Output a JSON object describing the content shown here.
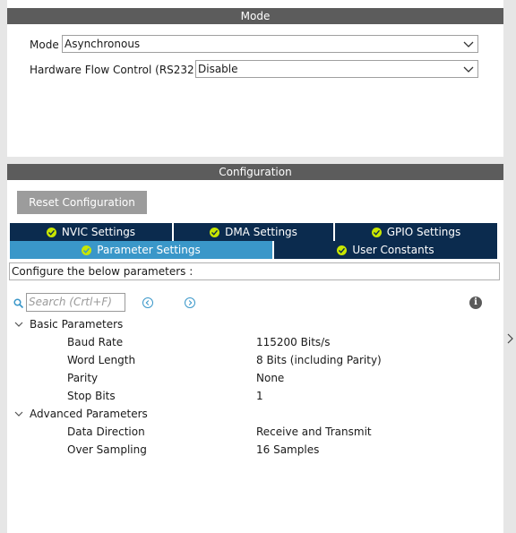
{
  "mode_panel": {
    "header": "Mode",
    "mode_label": "Mode",
    "mode_value": "Asynchronous",
    "flow_label": "Hardware Flow Control (RS232)",
    "flow_value": "Disable"
  },
  "config_panel": {
    "header": "Configuration",
    "reset_button": "Reset Configuration",
    "tabs": [
      {
        "label": "NVIC Settings",
        "active": false
      },
      {
        "label": "DMA Settings",
        "active": false
      },
      {
        "label": "GPIO Settings",
        "active": false
      },
      {
        "label": "Parameter Settings",
        "active": true
      },
      {
        "label": "User Constants",
        "active": false
      }
    ],
    "description": "Configure the below parameters :",
    "search_placeholder": "Search (Crtl+F)",
    "groups": [
      {
        "label": "Basic Parameters",
        "params": [
          {
            "name": "Baud Rate",
            "value": "115200 Bits/s"
          },
          {
            "name": "Word Length",
            "value": "8 Bits (including Parity)"
          },
          {
            "name": "Parity",
            "value": "None"
          },
          {
            "name": "Stop Bits",
            "value": "1"
          }
        ]
      },
      {
        "label": "Advanced Parameters",
        "params": [
          {
            "name": "Data Direction",
            "value": "Receive and Transmit"
          },
          {
            "name": "Over Sampling",
            "value": "16 Samples"
          }
        ]
      }
    ]
  },
  "colors": {
    "header_bg": "#5c5c5c",
    "tab_bg": "#0b2b4e",
    "tab_active_bg": "#3a97c9",
    "check_green": "#c8e600",
    "button_gray": "#9c9c9c"
  }
}
